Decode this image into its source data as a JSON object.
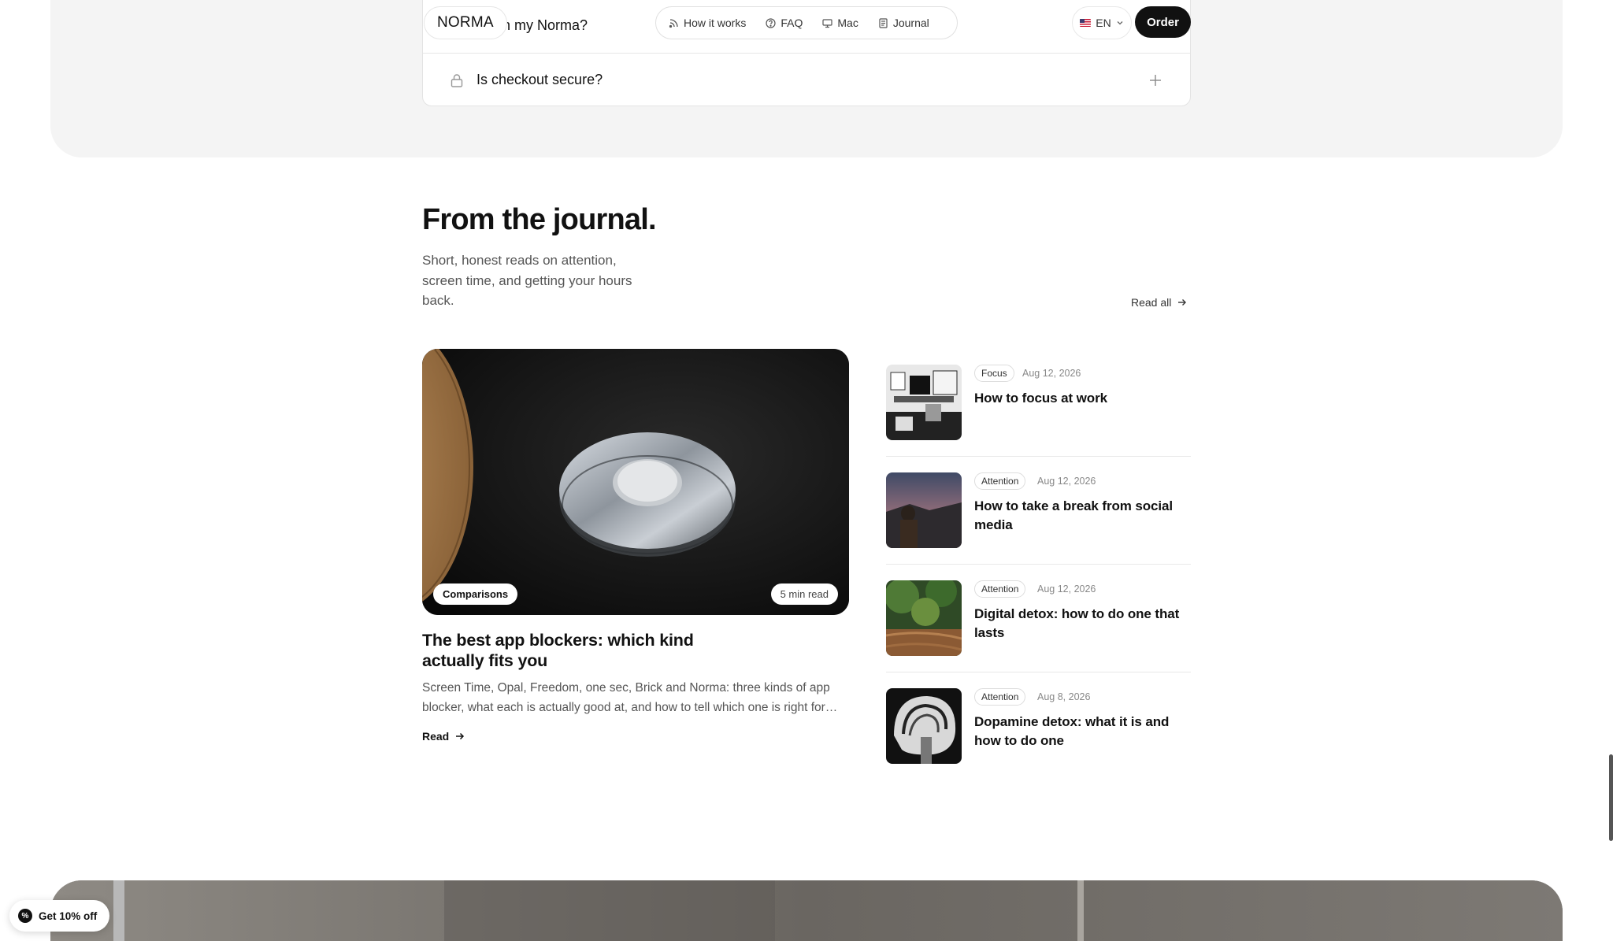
{
  "header": {
    "logo": "NORMA",
    "nav": [
      {
        "label": "How it works",
        "icon": "rss-icon"
      },
      {
        "label": "FAQ",
        "icon": "question-circle-icon"
      },
      {
        "label": "Mac",
        "icon": "monitor-icon"
      },
      {
        "label": "Journal",
        "icon": "document-icon"
      }
    ],
    "language": "EN",
    "order_label": "Order"
  },
  "faq": {
    "items": [
      {
        "question": "Can I return my Norma?",
        "visible_fragment": "I return my Norma?"
      },
      {
        "question": "Is checkout secure?",
        "icon": "lock-icon"
      }
    ]
  },
  "journal": {
    "title": "From the journal.",
    "subtitle": "Short, honest reads on attention, screen time, and getting your hours back.",
    "read_all": "Read all",
    "featured": {
      "category": "Comparisons",
      "read_time": "5 min read",
      "title": "The best app blockers: which kind actually fits you",
      "excerpt": "Screen Time, Opal, Freedom, one sec, Brick and Norma: three kinds of app blocker, what each is actually good at, and how to tell which one is right for you.",
      "read_label": "Read"
    },
    "posts": [
      {
        "tag": "Focus",
        "date": "Aug 12, 2026",
        "title": "How to focus at work"
      },
      {
        "tag": "Attention",
        "date": "Aug 12, 2026",
        "title": "How to take a break from social media"
      },
      {
        "tag": "Attention",
        "date": "Aug 12, 2026",
        "title": "Digital detox: how to do one that lasts"
      },
      {
        "tag": "Attention",
        "date": "Aug 8, 2026",
        "title": "Dopamine detox: what it is and how to do one"
      }
    ]
  },
  "promo": {
    "label": "Get 10% off",
    "icon_text": "%"
  },
  "colors": {
    "accent": "#111111",
    "band": "#f4f4f4"
  }
}
